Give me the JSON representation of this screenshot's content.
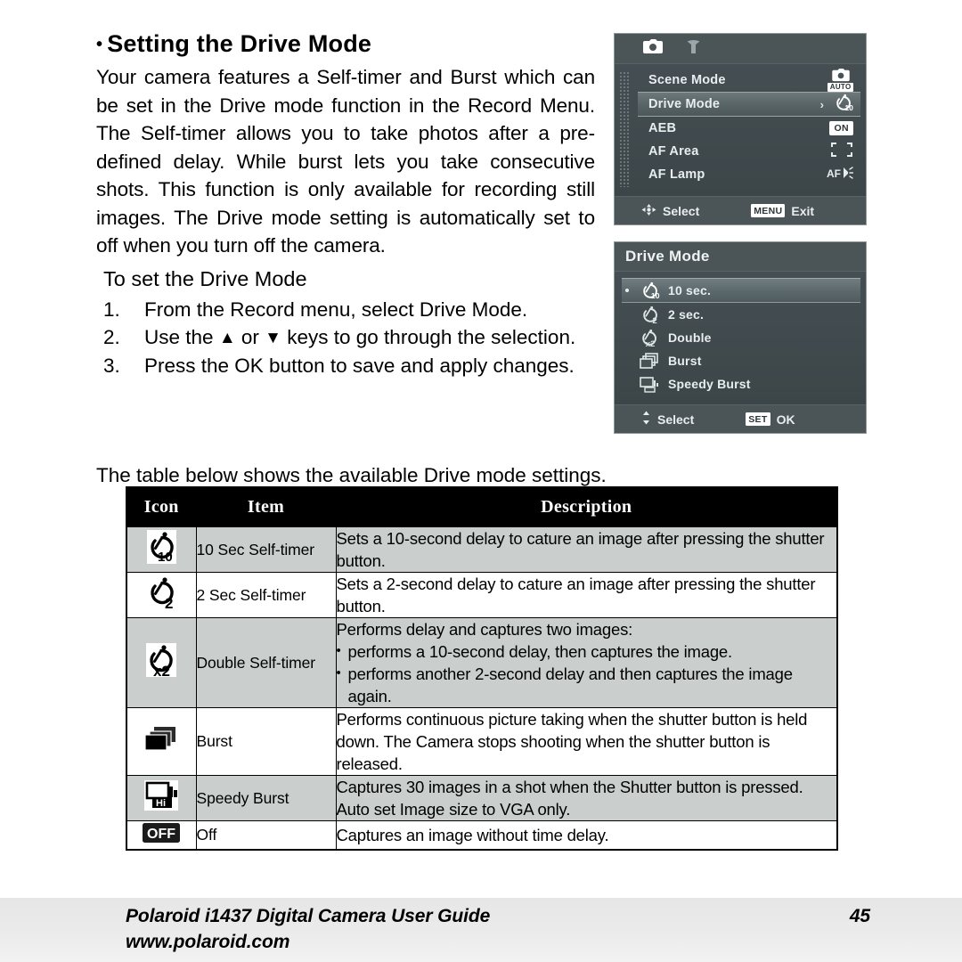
{
  "page": {
    "number": "45"
  },
  "article": {
    "heading": "Setting the Drive Mode",
    "heading_bullet": "•",
    "paragraph": "Your camera features a Self-timer and Burst which can be set in the Drive mode function in the Record Menu. The Self-timer allows you to take photos after a pre-defined delay. While burst lets you take consecutive shots. This function is only available for recording still images. The Drive mode setting is automatically set to off when you turn off the camera.",
    "subheading": "To set the Drive Mode",
    "steps": [
      {
        "num": "1.",
        "pre": "From the Record menu, select Drive Mode.",
        "up": "",
        "mid": "",
        "down": "",
        "post": ""
      },
      {
        "num": "2.",
        "pre": "Use the",
        "up": "▲",
        "mid": "or",
        "down": "▼",
        "post": "keys to go through the selection."
      },
      {
        "num": "3.",
        "pre": "Press the OK button to save and apply changes.",
        "up": "",
        "mid": "",
        "down": "",
        "post": ""
      }
    ],
    "table_intro": "The table below shows the available Drive mode settings."
  },
  "lcd_record_menu": {
    "tabs": [
      {
        "name": "camera-tab",
        "icon": "camera-icon"
      },
      {
        "name": "setup-tab",
        "icon": "wrench-icon"
      }
    ],
    "rows": [
      {
        "label": "Scene Mode",
        "chevron": "",
        "value_icon": "camera-auto-icon",
        "value_text": "AUTO",
        "selected": false
      },
      {
        "label": "Drive Mode",
        "chevron": "›",
        "value_icon": "self-timer-10s-icon",
        "value_text": "",
        "selected": true
      },
      {
        "label": "AEB",
        "chevron": "",
        "value_icon": "on-badge-icon",
        "value_text": "ON",
        "selected": false
      },
      {
        "label": "AF Area",
        "chevron": "",
        "value_icon": "af-frame-icon",
        "value_text": "",
        "selected": false
      },
      {
        "label": "AF Lamp",
        "chevron": "",
        "value_icon": "af-lamp-icon",
        "value_text": "AF",
        "selected": false
      }
    ],
    "bottom_bar": {
      "nav_icon": "four-way-arrow-icon",
      "nav_label": "Select",
      "key_badge": "MENU",
      "key_label": "Exit"
    }
  },
  "lcd_drive_mode": {
    "title": "Drive Mode",
    "options": [
      {
        "label": "10 sec.",
        "icon": "self-timer-10s-icon",
        "selected": true
      },
      {
        "label": "2 sec.",
        "icon": "self-timer-2s-icon",
        "selected": false
      },
      {
        "label": "Double",
        "icon": "self-timer-double-icon",
        "selected": false
      },
      {
        "label": "Burst",
        "icon": "burst-icon",
        "selected": false
      },
      {
        "label": "Speedy Burst",
        "icon": "speedy-burst-icon",
        "selected": false
      }
    ],
    "bottom_bar": {
      "nav_icon": "up-down-arrow-icon",
      "nav_label": "Select",
      "key_badge": "SET",
      "key_label": "OK"
    }
  },
  "table": {
    "headers": [
      "Icon",
      "Item",
      "Description"
    ],
    "rows": [
      {
        "icon": "self-timer-10s-icon",
        "item": "10 Sec Self-timer",
        "desc_text": "Sets a 10-second delay to cature an image after pressing the shutter button.",
        "desc_intro": "",
        "desc_bullets": [],
        "desc_cont": "",
        "shaded": true
      },
      {
        "icon": "self-timer-2s-icon",
        "item": "2 Sec Self-timer",
        "desc_text": "Sets a 2-second delay to cature an image after pressing the shutter button.",
        "desc_intro": "",
        "desc_bullets": [],
        "desc_cont": "",
        "shaded": false
      },
      {
        "icon": "self-timer-double-icon",
        "item": "Double Self-timer",
        "desc_text": "",
        "desc_intro": "Performs delay and captures two images:",
        "desc_bullets": [
          "performs a 10-second delay, then captures the image.",
          "performs another 2-second delay and then captures the image"
        ],
        "desc_cont": "again.",
        "shaded": true
      },
      {
        "icon": "burst-icon",
        "item": "Burst",
        "desc_text": "Performs continuous picture taking when the shutter button is held down. The Camera stops shooting when the shutter button is released.",
        "desc_intro": "",
        "desc_bullets": [],
        "desc_cont": "",
        "shaded": false
      },
      {
        "icon": "speedy-burst-icon",
        "item": "Speedy Burst",
        "desc_text": "Captures 30 images in a shot when the Shutter button is pressed. Auto set Image size to VGA only.",
        "desc_intro": "",
        "desc_bullets": [],
        "desc_cont": "",
        "shaded": true
      },
      {
        "icon": "off-badge-icon",
        "item": "Off",
        "desc_text": "Captures an image without time delay.",
        "desc_intro": "",
        "desc_bullets": [],
        "desc_cont": "",
        "shaded": false
      }
    ]
  },
  "footer": {
    "title": "Polaroid i1437 Digital Camera User Guide",
    "page": "45",
    "website": "www.polaroid.com"
  },
  "colors": {
    "lcd_bg": "#3f4b4f",
    "lcd_bar": "#4b5558",
    "table_header_bg": "#000000",
    "table_shaded_bg": "#cacfcd",
    "footer_bg": "#e9e9e9"
  }
}
